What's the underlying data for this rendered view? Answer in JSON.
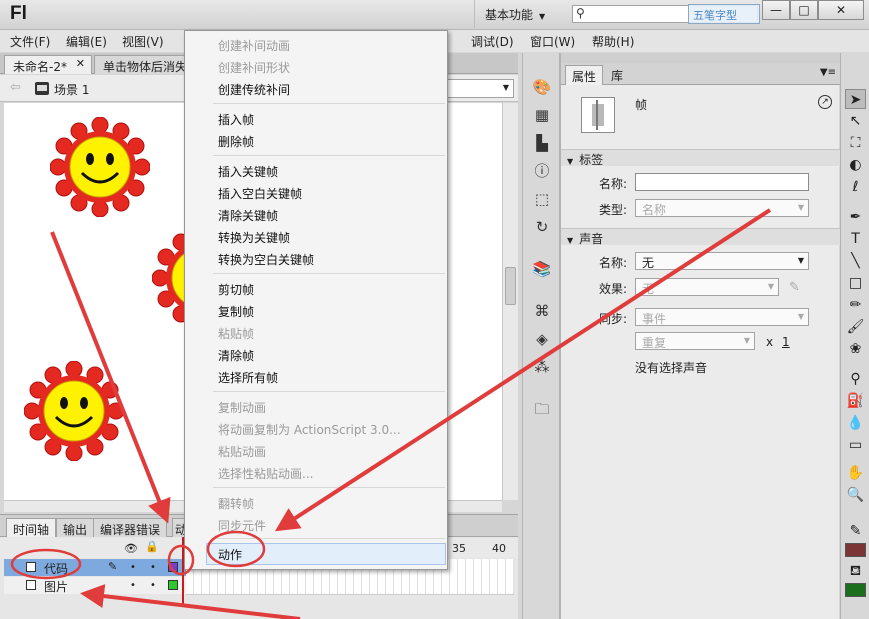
{
  "app": {
    "logo": "Fl",
    "workspace": "基本功能",
    "watermark": "五笔字型"
  },
  "window_controls": {
    "minimize": "—",
    "maximize": "□",
    "close": "✕"
  },
  "menubar": [
    "文件(F)",
    "编辑(E)",
    "视图(V)",
    "调试(D)",
    "窗口(W)",
    "帮助(H)"
  ],
  "document_tabs": [
    "未命名-2*",
    "单击物体后消失"
  ],
  "stage": {
    "scene": "场景 1"
  },
  "context_menu": {
    "items": [
      {
        "label": "创建补间动画",
        "enabled": false
      },
      {
        "label": "创建补间形状",
        "enabled": false
      },
      {
        "label": "创建传统补间",
        "enabled": true
      },
      {
        "label": "插入帧",
        "enabled": true
      },
      {
        "label": "删除帧",
        "enabled": true
      },
      {
        "label": "插入关键帧",
        "enabled": true
      },
      {
        "label": "插入空白关键帧",
        "enabled": true
      },
      {
        "label": "清除关键帧",
        "enabled": true
      },
      {
        "label": "转换为关键帧",
        "enabled": true
      },
      {
        "label": "转换为空白关键帧",
        "enabled": true
      },
      {
        "label": "剪切帧",
        "enabled": true
      },
      {
        "label": "复制帧",
        "enabled": true
      },
      {
        "label": "粘贴帧",
        "enabled": false
      },
      {
        "label": "清除帧",
        "enabled": true
      },
      {
        "label": "选择所有帧",
        "enabled": true
      },
      {
        "label": "复制动画",
        "enabled": false
      },
      {
        "label": "将动画复制为 ActionScript 3.0...",
        "enabled": false
      },
      {
        "label": "粘贴动画",
        "enabled": false
      },
      {
        "label": "选择性粘贴动画...",
        "enabled": false
      },
      {
        "label": "翻转帧",
        "enabled": false
      },
      {
        "label": "同步元件",
        "enabled": false
      },
      {
        "label": "动作",
        "enabled": true
      }
    ]
  },
  "timeline": {
    "tabs": [
      "时间轴",
      "输出",
      "编译器错误",
      "动"
    ],
    "frame_numbers": [
      "35",
      "40"
    ],
    "layers": [
      {
        "name": "代码",
        "selected": true,
        "color": "#7a3ec9"
      },
      {
        "name": "图片",
        "selected": false,
        "color": "#2ec72e"
      }
    ]
  },
  "properties": {
    "tabs": [
      "属性",
      "库"
    ],
    "title": "帧",
    "label_section": {
      "header": "标签",
      "name_label": "名称:",
      "name_value": "",
      "type_label": "类型:",
      "type_value": "名称"
    },
    "sound_section": {
      "header": "声音",
      "name_label": "名称:",
      "name_value": "无",
      "effect_label": "效果:",
      "effect_value": "无",
      "sync_label": "同步:",
      "sync_value": "事件",
      "repeat_value": "重复",
      "repeat_x": "x",
      "repeat_count": "1",
      "no_sound": "没有选择声音"
    }
  },
  "colors": {
    "stroke": "#7b3535",
    "fill": "#1b6e1b",
    "accent_red": "#e03c3c"
  }
}
